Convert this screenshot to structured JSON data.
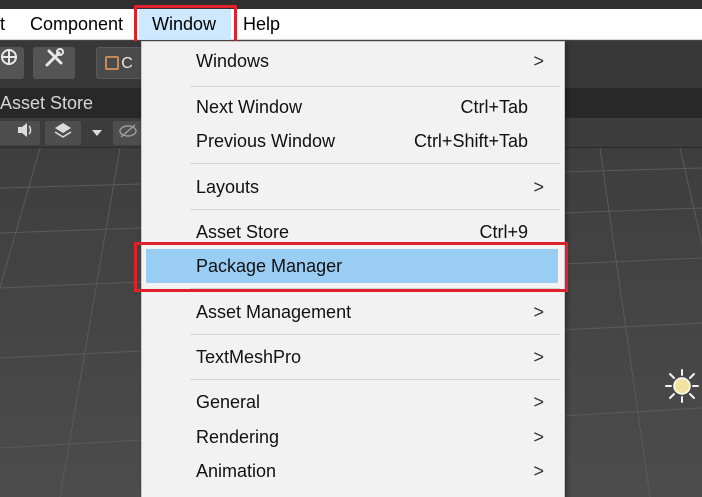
{
  "menubar": {
    "items": [
      {
        "label": "t"
      },
      {
        "label": "Component"
      },
      {
        "label": "Window"
      },
      {
        "label": "Help"
      }
    ]
  },
  "toolbar": {
    "c_button_label": "C"
  },
  "tab": {
    "label": "Asset Store"
  },
  "dropdown": {
    "items": [
      {
        "label": "Windows",
        "shortcut": "",
        "submenu": true
      },
      {
        "label": "Next Window",
        "shortcut": "Ctrl+Tab",
        "submenu": false
      },
      {
        "label": "Previous Window",
        "shortcut": "Ctrl+Shift+Tab",
        "submenu": false
      },
      {
        "label": "Layouts",
        "shortcut": "",
        "submenu": true
      },
      {
        "label": "Asset Store",
        "shortcut": "Ctrl+9",
        "submenu": false
      },
      {
        "label": "Package Manager",
        "shortcut": "",
        "submenu": false,
        "selected": true
      },
      {
        "label": "Asset Management",
        "shortcut": "",
        "submenu": true
      },
      {
        "label": "TextMeshPro",
        "shortcut": "",
        "submenu": true
      },
      {
        "label": "General",
        "shortcut": "",
        "submenu": true
      },
      {
        "label": "Rendering",
        "shortcut": "",
        "submenu": true
      },
      {
        "label": "Animation",
        "shortcut": "",
        "submenu": true
      }
    ],
    "submenu_arrow": ">"
  },
  "colors": {
    "highlight_outline": "#e0212b",
    "selected_item": "#99cdf3",
    "menu_bg": "#f2f2f2",
    "editor_bg": "#454545"
  },
  "icons": {
    "toolbar": [
      "move-tool-icon",
      "tools-icon"
    ],
    "scene": [
      "audio-icon",
      "layers-icon",
      "dropdown-icon",
      "visibility-icon",
      "sun-icon"
    ]
  }
}
